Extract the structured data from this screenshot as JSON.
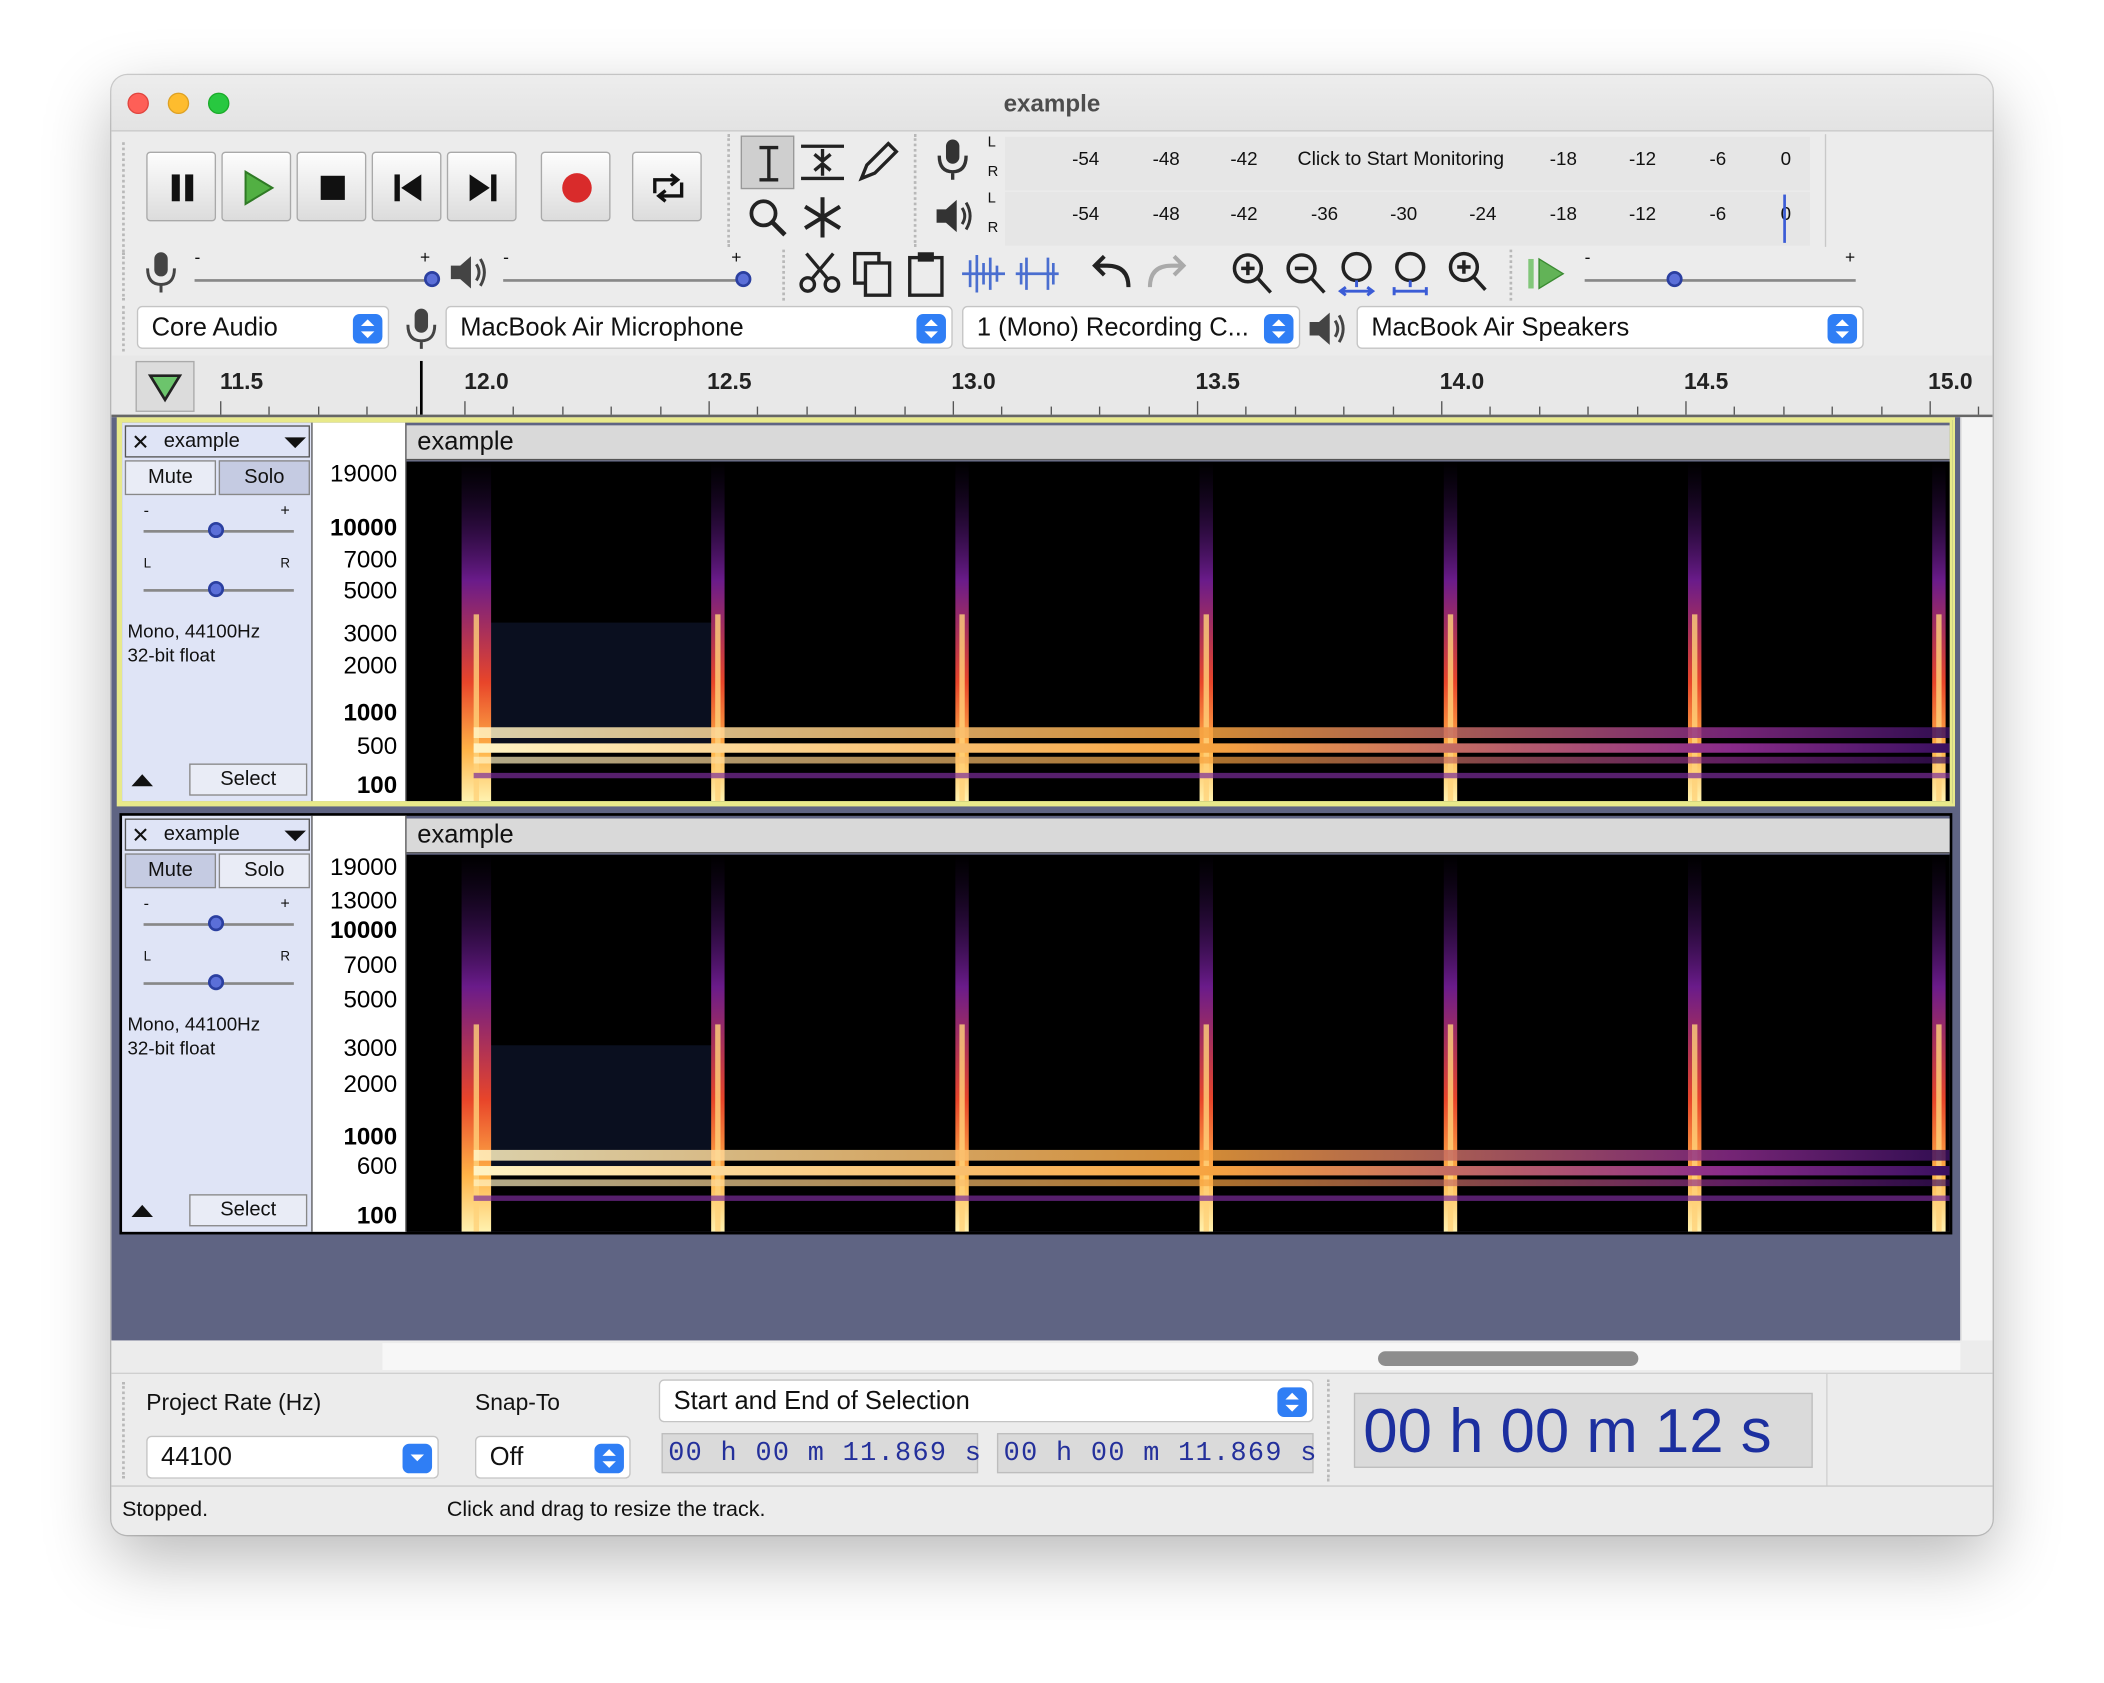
{
  "window": {
    "title": "example"
  },
  "transport": {
    "buttons": [
      "pause",
      "play",
      "stop",
      "skip-to-start",
      "skip-to-end",
      "record",
      "loop"
    ]
  },
  "meters": {
    "record_ticks": [
      "-54",
      "-48",
      "-42",
      "Click to Start Monitoring",
      "-18",
      "-12",
      "-6",
      "0"
    ],
    "play_ticks": [
      "-54",
      "-48",
      "-42",
      "-36",
      "-30",
      "-24",
      "-18",
      "-12",
      "-6",
      "0"
    ],
    "left": "L",
    "right": "R"
  },
  "mixer": {
    "minus": "-",
    "plus": "+"
  },
  "device": {
    "host": "Core Audio",
    "input": "MacBook Air Microphone",
    "channels": "1 (Mono) Recording C...",
    "output": "MacBook Air Speakers"
  },
  "ruler": {
    "labels": [
      "11.5",
      "12.0",
      "12.5",
      "13.0",
      "13.5",
      "14.0",
      "14.5",
      "15.0"
    ]
  },
  "tracks": [
    {
      "name": "example",
      "clip_name": "example",
      "mute": "Mute",
      "solo": "Solo",
      "gain_minus": "-",
      "gain_plus": "+",
      "pan_left": "L",
      "pan_right": "R",
      "format": "Mono, 44100Hz",
      "bits": "32-bit float",
      "select": "Select",
      "hz_labels": [
        "19000",
        "10000",
        "7000",
        "5000",
        "3000",
        "2000",
        "1000",
        "500",
        "100"
      ]
    },
    {
      "name": "example",
      "clip_name": "example",
      "mute": "Mute",
      "solo": "Solo",
      "gain_minus": "-",
      "gain_plus": "+",
      "pan_left": "L",
      "pan_right": "R",
      "format": "Mono, 44100Hz",
      "bits": "32-bit float",
      "select": "Select",
      "hz_labels": [
        "19000",
        "13000",
        "10000",
        "7000",
        "5000",
        "3000",
        "2000",
        "1000",
        "600",
        "100"
      ]
    }
  ],
  "selection": {
    "project_rate_label": "Project Rate (Hz)",
    "project_rate": "44100",
    "snap_label": "Snap-To",
    "snap": "Off",
    "mode": "Start and End of Selection",
    "start": "00 h 00 m 11.869 s",
    "end": "00 h 00 m 11.869 s",
    "position": "00 h 00 m 12 s"
  },
  "status": {
    "state": "Stopped.",
    "hint": "Click and drag to resize the track."
  },
  "colors": {
    "accent": "#2f7ef5",
    "track_bg": "#5f6483",
    "timecode": "#24309b"
  }
}
